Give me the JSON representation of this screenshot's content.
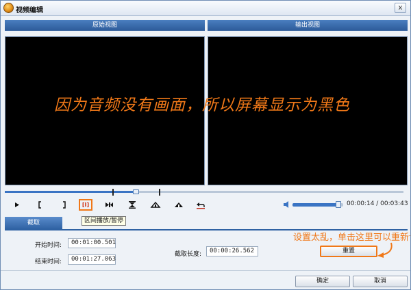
{
  "window": {
    "title": "视频编辑",
    "close_glyph": "x"
  },
  "panels": {
    "source_label": "原始视图",
    "output_label": "输出视图"
  },
  "overlay_note": "因为音频没有画面，所以屏幕显示为黑色",
  "controls": {
    "playback_position": 0.33,
    "in_mark_position": 0.27,
    "out_mark_position": 0.38,
    "range_play_label": "[I]",
    "tooltip": "区间播放/暂停",
    "volume_level": 0.9,
    "time_display": "00:00:14 / 00:03:43"
  },
  "tab": {
    "label": "截取"
  },
  "form": {
    "start_label": "开始时间:",
    "start_value": "00:01:00.501",
    "end_label": "结束时间:",
    "end_value": "00:01:27.063",
    "length_label": "截取长度:",
    "length_value": "00:00:26.562"
  },
  "hint": "设置太乱，单击这里可以重新设置",
  "buttons": {
    "reset": "重置",
    "ok": "确定",
    "cancel": "取消"
  },
  "colors": {
    "accent_orange": "#f07818",
    "header_blue": "#2c5a99",
    "track_blue": "#3a74c4"
  }
}
